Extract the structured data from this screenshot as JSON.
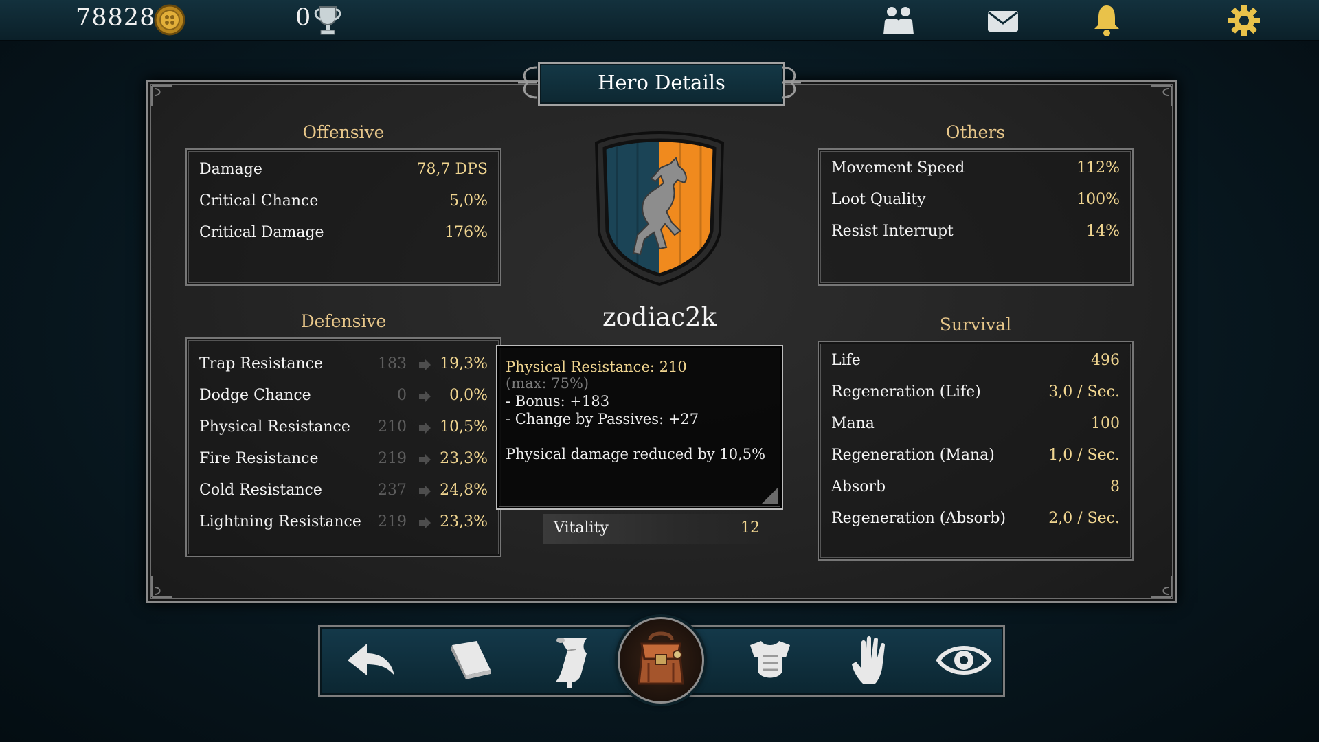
{
  "topbar": {
    "coins": "78828",
    "trophies": "0",
    "icons": [
      "coin-icon",
      "trophy-icon",
      "friends-icon",
      "mail-icon",
      "bell-icon",
      "gear-icon"
    ]
  },
  "panel": {
    "title": "Hero Details",
    "player_name": "zodiac2k",
    "crest": {
      "left_color": "#1b4456",
      "right_color": "#f08a1e",
      "emblem": "rearing-horse-icon"
    }
  },
  "offensive": {
    "title": "Offensive",
    "rows": [
      {
        "label": "Damage",
        "value": "78,7 DPS"
      },
      {
        "label": "Critical Chance",
        "value": "5,0%"
      },
      {
        "label": "Critical Damage",
        "value": "176%"
      }
    ]
  },
  "defensive": {
    "title": "Defensive",
    "rows": [
      {
        "label": "Trap Resistance",
        "base": "183",
        "value": "19,3%"
      },
      {
        "label": "Dodge Chance",
        "base": "0",
        "value": "0,0%"
      },
      {
        "label": "Physical Resistance",
        "base": "210",
        "value": "10,5%"
      },
      {
        "label": "Fire Resistance",
        "base": "219",
        "value": "23,3%"
      },
      {
        "label": "Cold Resistance",
        "base": "237",
        "value": "24,8%"
      },
      {
        "label": "Lightning Resistance",
        "base": "219",
        "value": "23,3%"
      }
    ]
  },
  "others": {
    "title": "Others",
    "rows": [
      {
        "label": "Movement Speed",
        "value": "112%"
      },
      {
        "label": "Loot Quality",
        "value": "100%"
      },
      {
        "label": "Resist Interrupt",
        "value": "14%"
      }
    ]
  },
  "survival": {
    "title": "Survival",
    "rows": [
      {
        "label": "Life",
        "value": "496"
      },
      {
        "label": "Regeneration (Life)",
        "value": "3,0 / Sec."
      },
      {
        "label": "Mana",
        "value": "100"
      },
      {
        "label": "Regeneration (Mana)",
        "value": "1,0 / Sec."
      },
      {
        "label": "Absorb",
        "value": "8"
      },
      {
        "label": "Regeneration (Absorb)",
        "value": "2,0 / Sec."
      }
    ]
  },
  "tooltip": {
    "title": "Physical Resistance: 210",
    "max": "(max: 75%)",
    "bonus": "- Bonus: +183",
    "passives": "- Change by Passives: +27",
    "description": "Physical damage reduced by 10,5%"
  },
  "vitality": {
    "label": "Vitality",
    "value": "12"
  },
  "bottom_nav": [
    "back-arrow-icon",
    "book-icon",
    "scroll-icon",
    "backpack-icon",
    "armor-icon",
    "hand-icon",
    "eye-icon"
  ],
  "colors": {
    "gold_text": "#f0d590",
    "section_title": "#e8c78a",
    "bar_teal": "#14394a"
  }
}
